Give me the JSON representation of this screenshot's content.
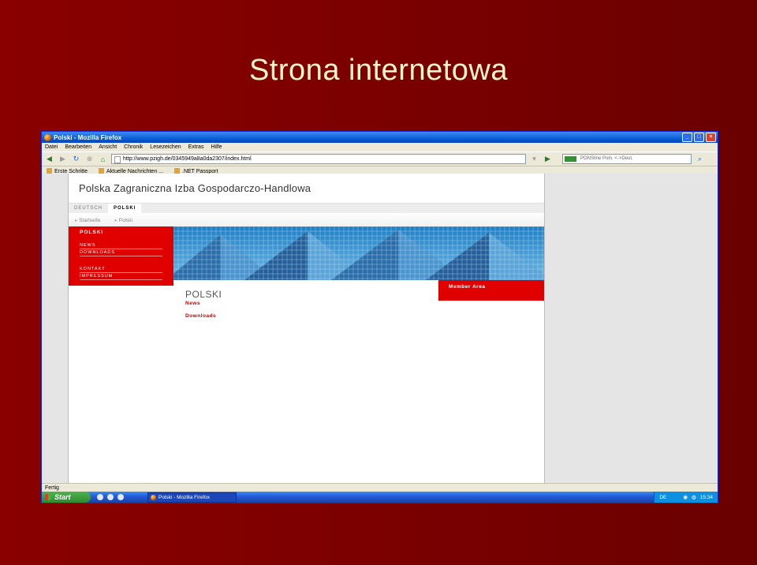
{
  "slide": {
    "title": "Strona internetowa"
  },
  "browser": {
    "window_title": "Polski - Mozilla Firefox",
    "menu": [
      "Datei",
      "Bearbeiten",
      "Ansicht",
      "Chronik",
      "Lesezeichen",
      "Extras",
      "Hilfe"
    ],
    "url": "http://www.pzigh.de/0345949a8a0da2307/index.html",
    "search_placeholder": "PONSline Poln. <->Deut.",
    "bookmarks": [
      "Erste Schritte",
      "Aktuelle Nachrichten ...",
      ".NET Passport"
    ],
    "status": "Fertig"
  },
  "site": {
    "brand": "Polska Zagraniczna Izba Gospodarczo-Handlowa",
    "lang_tabs": [
      "DEUTSCH",
      "POLSKI"
    ],
    "breadcrumb": [
      "Startseite",
      "Polski"
    ],
    "sidebar_heading": "POLSKI",
    "sidebar_group1": [
      "NEWS",
      "DOWNLOADS"
    ],
    "sidebar_group2": [
      "KONTAKT",
      "IMPRESSUM"
    ],
    "member_area": "Member Area",
    "page_title": "POLSKI",
    "links": [
      "News",
      "Downloads"
    ]
  },
  "taskbar": {
    "start": "Start",
    "item": "Polski - Mozilla Firefox",
    "lang": "DE",
    "clock": "15:34"
  },
  "colors": {
    "slide_bg": "#7a0000",
    "site_red": "#e00000",
    "xp_blue": "#245edb"
  }
}
